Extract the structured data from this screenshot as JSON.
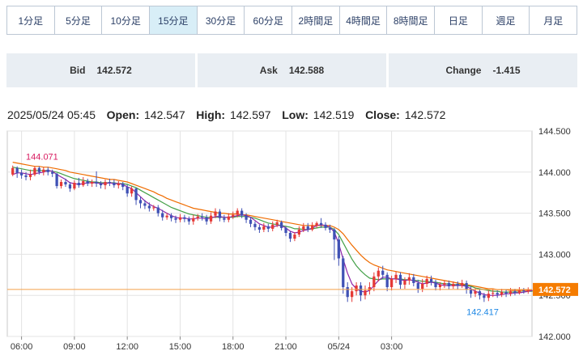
{
  "timeframe_tabs": [
    {
      "label": "1分足",
      "active": false
    },
    {
      "label": "5分足",
      "active": false
    },
    {
      "label": "10分足",
      "active": false
    },
    {
      "label": "15分足",
      "active": true
    },
    {
      "label": "30分足",
      "active": false
    },
    {
      "label": "60分足",
      "active": false
    },
    {
      "label": "2時間足",
      "active": false
    },
    {
      "label": "4時間足",
      "active": false
    },
    {
      "label": "8時間足",
      "active": false
    },
    {
      "label": "日足",
      "active": false
    },
    {
      "label": "週足",
      "active": false
    },
    {
      "label": "月足",
      "active": false
    }
  ],
  "quote": {
    "bid_label": "Bid",
    "bid_value": "142.572",
    "ask_label": "Ask",
    "ask_value": "142.588",
    "change_label": "Change",
    "change_value": "-1.415"
  },
  "ohlc": {
    "datetime": "2025/05/24 05:45",
    "open_label": "Open:",
    "open": "142.547",
    "high_label": "High:",
    "high": "142.597",
    "low_label": "Low:",
    "low": "142.519",
    "close_label": "Close:",
    "close": "142.572"
  },
  "colors": {
    "up": "#e53935",
    "down": "#3f51b5",
    "ma_short": "#8e24aa",
    "ma_mid": "#43a047",
    "ma_long": "#ef6c00",
    "price_line": "#f5a04a",
    "price_tag": "#f57c00",
    "max_label": "#d81b60",
    "min_label": "#1e88e5",
    "grid": "#e3e3e3"
  },
  "chart_data": {
    "type": "candlestick",
    "x_ticks": [
      "06:00",
      "09:00",
      "12:00",
      "15:00",
      "18:00",
      "21:00",
      "05/24",
      "03:00"
    ],
    "y_ticks": [
      "144.500",
      "144.000",
      "143.500",
      "143.000",
      "142.500",
      "142.000"
    ],
    "ylim": [
      142.0,
      144.5
    ],
    "current_price": "142.572",
    "max_label": "144.071",
    "min_label": "142.417",
    "candles": [
      [
        143.97,
        144.05,
        144.08,
        143.95
      ],
      [
        144.05,
        143.99,
        144.07,
        143.93
      ],
      [
        143.99,
        143.96,
        144.03,
        143.92
      ],
      [
        143.96,
        143.94,
        144.0,
        143.9
      ],
      [
        143.94,
        143.97,
        144.03,
        143.9
      ],
      [
        143.97,
        144.05,
        144.07,
        143.95
      ],
      [
        144.05,
        144.0,
        144.07,
        143.97
      ],
      [
        144.0,
        144.03,
        144.06,
        143.96
      ],
      [
        144.03,
        144.0,
        144.06,
        143.96
      ],
      [
        144.0,
        143.98,
        144.03,
        143.94
      ],
      [
        143.98,
        143.83,
        143.99,
        143.8
      ],
      [
        143.83,
        143.88,
        143.91,
        143.8
      ],
      [
        143.88,
        143.85,
        143.92,
        143.82
      ],
      [
        143.85,
        143.8,
        143.88,
        143.76
      ],
      [
        143.8,
        143.87,
        143.9,
        143.78
      ],
      [
        143.87,
        143.84,
        143.93,
        143.81
      ],
      [
        143.84,
        143.89,
        143.94,
        143.82
      ],
      [
        143.89,
        143.86,
        143.92,
        143.83
      ],
      [
        143.86,
        143.88,
        143.91,
        143.82
      ],
      [
        143.88,
        143.86,
        144.01,
        143.82
      ],
      [
        143.86,
        143.84,
        143.89,
        143.8
      ],
      [
        143.84,
        143.88,
        143.91,
        143.79
      ],
      [
        143.88,
        143.87,
        143.92,
        143.83
      ],
      [
        143.87,
        143.84,
        143.91,
        143.81
      ],
      [
        143.84,
        143.86,
        143.89,
        143.8
      ],
      [
        143.86,
        143.82,
        143.88,
        143.78
      ],
      [
        143.82,
        143.74,
        143.85,
        143.7
      ],
      [
        143.74,
        143.8,
        143.83,
        143.7
      ],
      [
        143.8,
        143.66,
        143.81,
        143.6
      ],
      [
        143.66,
        143.62,
        143.7,
        143.56
      ],
      [
        143.62,
        143.59,
        143.66,
        143.55
      ],
      [
        143.59,
        143.56,
        143.63,
        143.52
      ],
      [
        143.56,
        143.57,
        143.6,
        143.53
      ],
      [
        143.57,
        143.5,
        143.6,
        143.46
      ],
      [
        143.5,
        143.45,
        143.54,
        143.41
      ],
      [
        143.45,
        143.47,
        143.5,
        143.42
      ],
      [
        143.47,
        143.44,
        143.5,
        143.4
      ],
      [
        143.44,
        143.42,
        143.47,
        143.38
      ],
      [
        143.42,
        143.45,
        143.49,
        143.39
      ],
      [
        143.45,
        143.43,
        143.48,
        143.39
      ],
      [
        143.43,
        143.4,
        143.46,
        143.36
      ],
      [
        143.4,
        143.44,
        143.48,
        143.36
      ],
      [
        143.44,
        143.46,
        143.49,
        143.41
      ],
      [
        143.46,
        143.45,
        143.5,
        143.41
      ],
      [
        143.45,
        143.4,
        143.48,
        143.36
      ],
      [
        143.4,
        143.47,
        143.51,
        143.37
      ],
      [
        143.47,
        143.52,
        143.56,
        143.44
      ],
      [
        143.52,
        143.44,
        143.55,
        143.4
      ],
      [
        143.44,
        143.42,
        143.48,
        143.39
      ],
      [
        143.42,
        143.46,
        143.5,
        143.39
      ],
      [
        143.46,
        143.48,
        143.52,
        143.43
      ],
      [
        143.48,
        143.53,
        143.56,
        143.45
      ],
      [
        143.53,
        143.47,
        143.56,
        143.44
      ],
      [
        143.47,
        143.42,
        143.5,
        143.38
      ],
      [
        143.42,
        143.37,
        143.45,
        143.33
      ],
      [
        143.37,
        143.33,
        143.4,
        143.29
      ],
      [
        143.33,
        143.3,
        143.36,
        143.26
      ],
      [
        143.3,
        143.34,
        143.38,
        143.27
      ],
      [
        143.34,
        143.31,
        143.37,
        143.27
      ],
      [
        143.31,
        143.36,
        143.4,
        143.28
      ],
      [
        143.36,
        143.39,
        143.42,
        143.33
      ],
      [
        143.39,
        143.32,
        143.41,
        143.29
      ],
      [
        143.32,
        143.26,
        143.34,
        143.22
      ],
      [
        143.26,
        143.19,
        143.28,
        143.15
      ],
      [
        143.19,
        143.24,
        143.27,
        143.16
      ],
      [
        143.24,
        143.3,
        143.34,
        143.21
      ],
      [
        143.3,
        143.34,
        143.38,
        143.27
      ],
      [
        143.34,
        143.3,
        143.38,
        143.27
      ],
      [
        143.3,
        143.35,
        143.39,
        143.28
      ],
      [
        143.35,
        143.38,
        143.4,
        143.32
      ],
      [
        143.38,
        143.36,
        143.44,
        143.32
      ],
      [
        143.36,
        143.32,
        143.39,
        143.29
      ],
      [
        143.32,
        143.3,
        143.36,
        143.26
      ],
      [
        143.3,
        143.18,
        143.32,
        142.93
      ],
      [
        143.18,
        142.95,
        143.22,
        142.86
      ],
      [
        142.95,
        142.6,
        142.98,
        142.52
      ],
      [
        142.6,
        142.48,
        142.66,
        142.42
      ],
      [
        142.48,
        142.55,
        142.6,
        142.42
      ],
      [
        142.55,
        142.62,
        142.66,
        142.5
      ],
      [
        142.62,
        142.5,
        142.66,
        142.43
      ],
      [
        142.5,
        142.56,
        142.62,
        142.45
      ],
      [
        142.56,
        142.6,
        142.66,
        142.51
      ],
      [
        142.6,
        142.73,
        142.78,
        142.55
      ],
      [
        142.73,
        142.8,
        142.84,
        142.67
      ],
      [
        142.8,
        142.75,
        142.86,
        142.7
      ],
      [
        142.75,
        142.6,
        142.78,
        142.55
      ],
      [
        142.6,
        142.7,
        142.74,
        142.56
      ],
      [
        142.7,
        142.75,
        142.79,
        142.65
      ],
      [
        142.75,
        142.63,
        142.78,
        142.58
      ],
      [
        142.63,
        142.68,
        142.72,
        142.58
      ],
      [
        142.68,
        142.72,
        142.77,
        142.63
      ],
      [
        142.72,
        142.65,
        142.76,
        142.61
      ],
      [
        142.65,
        142.58,
        142.69,
        142.53
      ],
      [
        142.58,
        142.64,
        142.7,
        142.54
      ],
      [
        142.64,
        142.7,
        142.74,
        142.6
      ],
      [
        142.7,
        142.66,
        142.74,
        142.62
      ],
      [
        142.66,
        142.6,
        142.69,
        142.56
      ],
      [
        142.6,
        142.63,
        142.66,
        142.56
      ],
      [
        142.63,
        142.65,
        142.68,
        142.59
      ],
      [
        142.65,
        142.61,
        142.68,
        142.57
      ],
      [
        142.61,
        142.64,
        142.67,
        142.58
      ],
      [
        142.64,
        142.62,
        142.67,
        142.57
      ],
      [
        142.62,
        142.65,
        142.69,
        142.59
      ],
      [
        142.65,
        142.57,
        142.68,
        142.52
      ],
      [
        142.57,
        142.52,
        142.61,
        142.47
      ],
      [
        142.52,
        142.55,
        142.59,
        142.48
      ],
      [
        142.55,
        142.5,
        142.58,
        142.45
      ],
      [
        142.5,
        142.47,
        142.53,
        142.42
      ],
      [
        142.47,
        142.52,
        142.56,
        142.43
      ],
      [
        142.52,
        142.53,
        142.57,
        142.48
      ],
      [
        142.53,
        142.51,
        142.56,
        142.47
      ],
      [
        142.51,
        142.54,
        142.58,
        142.48
      ],
      [
        142.54,
        142.52,
        142.57,
        142.48
      ],
      [
        142.52,
        142.55,
        142.59,
        142.49
      ],
      [
        142.55,
        142.53,
        142.58,
        142.5
      ],
      [
        142.53,
        142.56,
        142.6,
        142.51
      ],
      [
        142.56,
        142.55,
        142.59,
        142.52
      ],
      [
        142.547,
        142.572,
        142.597,
        142.519
      ]
    ],
    "ma_short": [
      143.97,
      143.99,
      143.99,
      143.98,
      143.97,
      143.98,
      143.99,
      144.0,
      144.02,
      144.01,
      143.97,
      143.94,
      143.91,
      143.87,
      143.86,
      143.85,
      143.86,
      143.87,
      143.87,
      143.87,
      143.86,
      143.86,
      143.87,
      143.86,
      143.86,
      143.85,
      143.82,
      143.8,
      143.75,
      143.7,
      143.65,
      143.61,
      143.58,
      143.56,
      143.53,
      143.5,
      143.47,
      143.45,
      143.44,
      143.44,
      143.43,
      143.43,
      143.44,
      143.44,
      143.43,
      143.44,
      143.46,
      143.46,
      143.45,
      143.45,
      143.46,
      143.47,
      143.48,
      143.47,
      143.45,
      143.41,
      143.37,
      143.35,
      143.33,
      143.33,
      143.35,
      143.35,
      143.32,
      143.28,
      143.26,
      143.27,
      143.29,
      143.3,
      143.32,
      143.35,
      143.36,
      143.35,
      143.33,
      143.27,
      143.13,
      142.94,
      142.77,
      142.64,
      142.58,
      142.55,
      142.54,
      142.56,
      142.62,
      142.68,
      142.72,
      142.72,
      142.7,
      142.7,
      142.69,
      142.68,
      142.69,
      142.68,
      142.66,
      142.64,
      142.65,
      142.66,
      142.65,
      142.63,
      142.62,
      142.62,
      142.62,
      142.62,
      142.62,
      142.61,
      142.58,
      142.55,
      142.53,
      142.51,
      142.5,
      142.5,
      142.5,
      142.51,
      142.52,
      142.52,
      142.53,
      142.53,
      142.54,
      142.55,
      142.56
    ],
    "ma_mid": [
      144.06,
      144.05,
      144.04,
      144.03,
      144.02,
      144.02,
      144.02,
      144.02,
      144.02,
      144.01,
      144.0,
      143.98,
      143.96,
      143.94,
      143.92,
      143.91,
      143.9,
      143.89,
      143.88,
      143.88,
      143.87,
      143.87,
      143.87,
      143.87,
      143.86,
      143.86,
      143.85,
      143.83,
      143.81,
      143.78,
      143.75,
      143.72,
      143.69,
      143.66,
      143.63,
      143.6,
      143.57,
      143.55,
      143.53,
      143.51,
      143.49,
      143.48,
      143.47,
      143.46,
      143.45,
      143.45,
      143.45,
      143.45,
      143.45,
      143.45,
      143.45,
      143.46,
      143.46,
      143.46,
      143.45,
      143.44,
      143.42,
      143.4,
      143.38,
      143.37,
      143.36,
      143.35,
      143.34,
      143.33,
      143.31,
      143.31,
      143.3,
      143.3,
      143.31,
      143.32,
      143.33,
      143.33,
      143.33,
      143.3,
      143.24,
      143.14,
      143.04,
      142.94,
      142.86,
      142.8,
      142.75,
      142.71,
      142.7,
      142.69,
      142.7,
      142.7,
      142.7,
      142.7,
      142.7,
      142.69,
      142.69,
      142.68,
      142.68,
      142.67,
      142.67,
      142.66,
      142.66,
      142.65,
      142.64,
      142.64,
      142.63,
      142.63,
      142.63,
      142.62,
      142.61,
      142.59,
      142.58,
      142.57,
      142.56,
      142.55,
      142.55,
      142.54,
      142.54,
      142.54,
      142.54,
      142.54,
      142.54,
      142.55,
      142.55
    ],
    "ma_long": [
      144.12,
      144.11,
      144.1,
      144.09,
      144.08,
      144.07,
      144.07,
      144.06,
      144.06,
      144.05,
      144.04,
      144.03,
      144.02,
      144.0,
      143.99,
      143.98,
      143.97,
      143.96,
      143.95,
      143.94,
      143.93,
      143.92,
      143.91,
      143.91,
      143.9,
      143.89,
      143.88,
      143.86,
      143.84,
      143.82,
      143.8,
      143.78,
      143.76,
      143.73,
      143.71,
      143.68,
      143.66,
      143.64,
      143.62,
      143.6,
      143.58,
      143.56,
      143.55,
      143.54,
      143.53,
      143.52,
      143.51,
      143.5,
      143.5,
      143.49,
      143.49,
      143.49,
      143.48,
      143.48,
      143.47,
      143.46,
      143.45,
      143.44,
      143.43,
      143.42,
      143.41,
      143.4,
      143.39,
      143.38,
      143.37,
      143.36,
      143.35,
      143.35,
      143.35,
      143.35,
      143.35,
      143.35,
      143.35,
      143.33,
      143.3,
      143.25,
      143.18,
      143.11,
      143.05,
      142.99,
      142.94,
      142.9,
      142.87,
      142.85,
      142.83,
      142.81,
      142.8,
      142.79,
      142.78,
      142.77,
      142.76,
      142.75,
      142.74,
      142.73,
      142.72,
      142.71,
      142.7,
      142.69,
      142.68,
      142.67,
      142.66,
      142.65,
      142.64,
      142.63,
      142.62,
      142.61,
      142.6,
      142.59,
      142.58,
      142.58,
      142.57,
      142.57,
      142.57,
      142.56,
      142.56,
      142.56,
      142.56,
      142.56,
      142.56
    ]
  }
}
